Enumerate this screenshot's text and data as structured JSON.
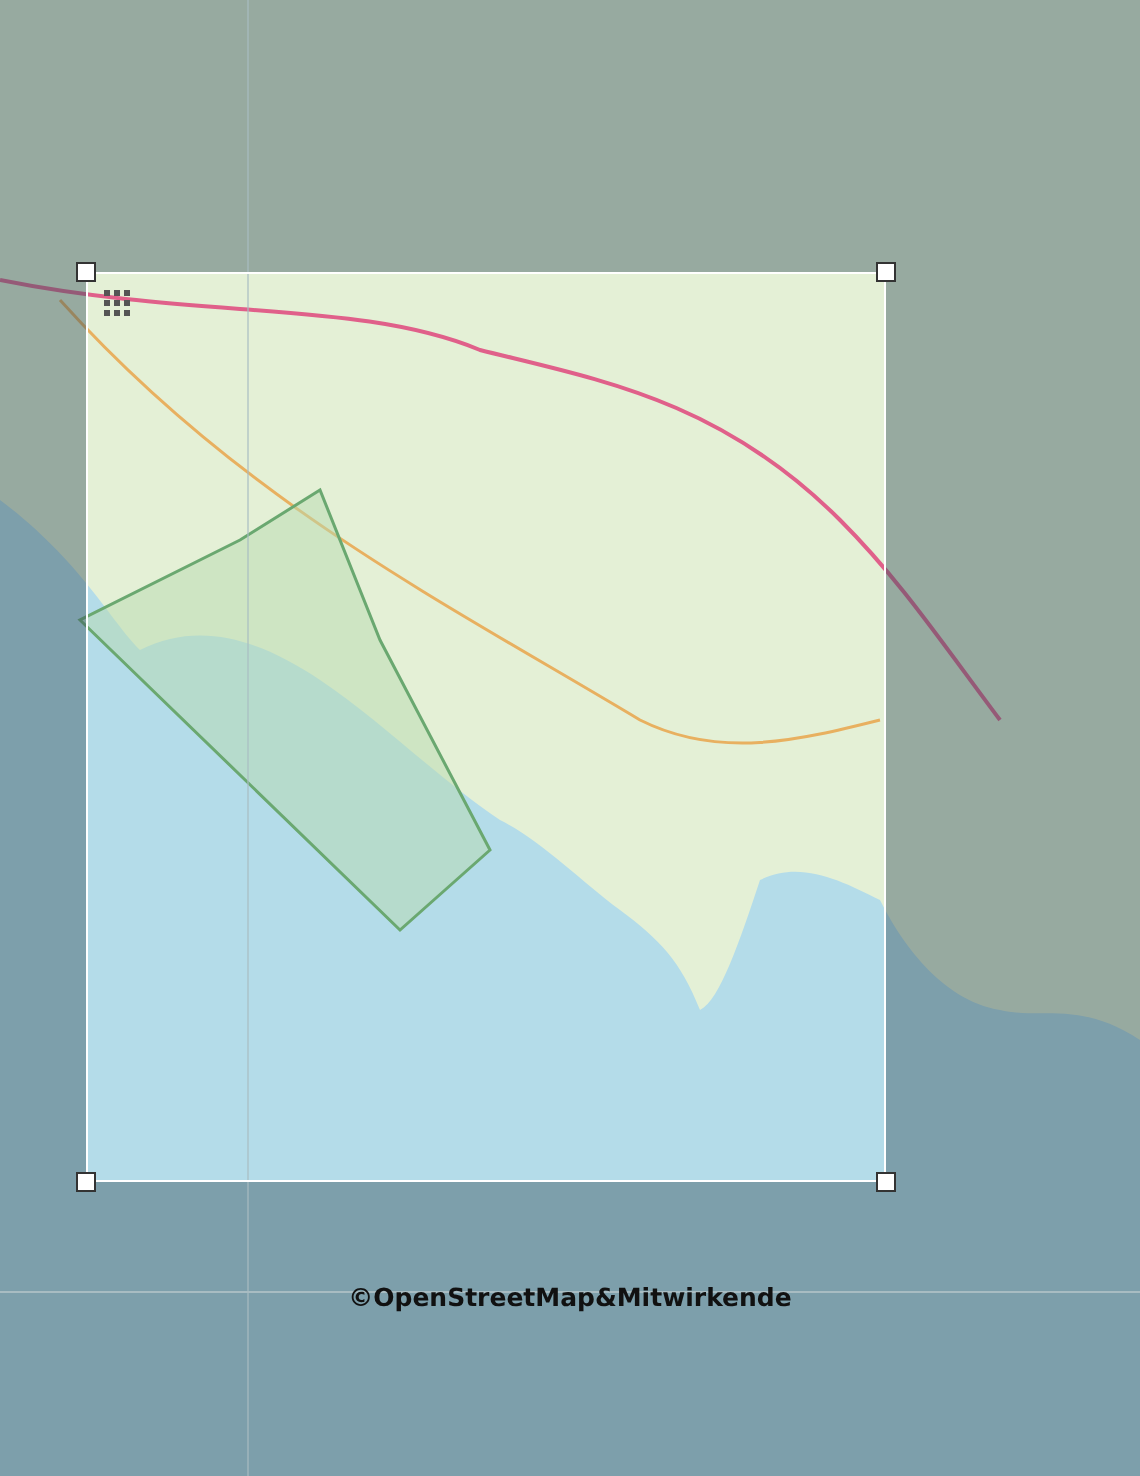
{
  "attribution": "©OpenStreetMap&Mitwirkende"
}
